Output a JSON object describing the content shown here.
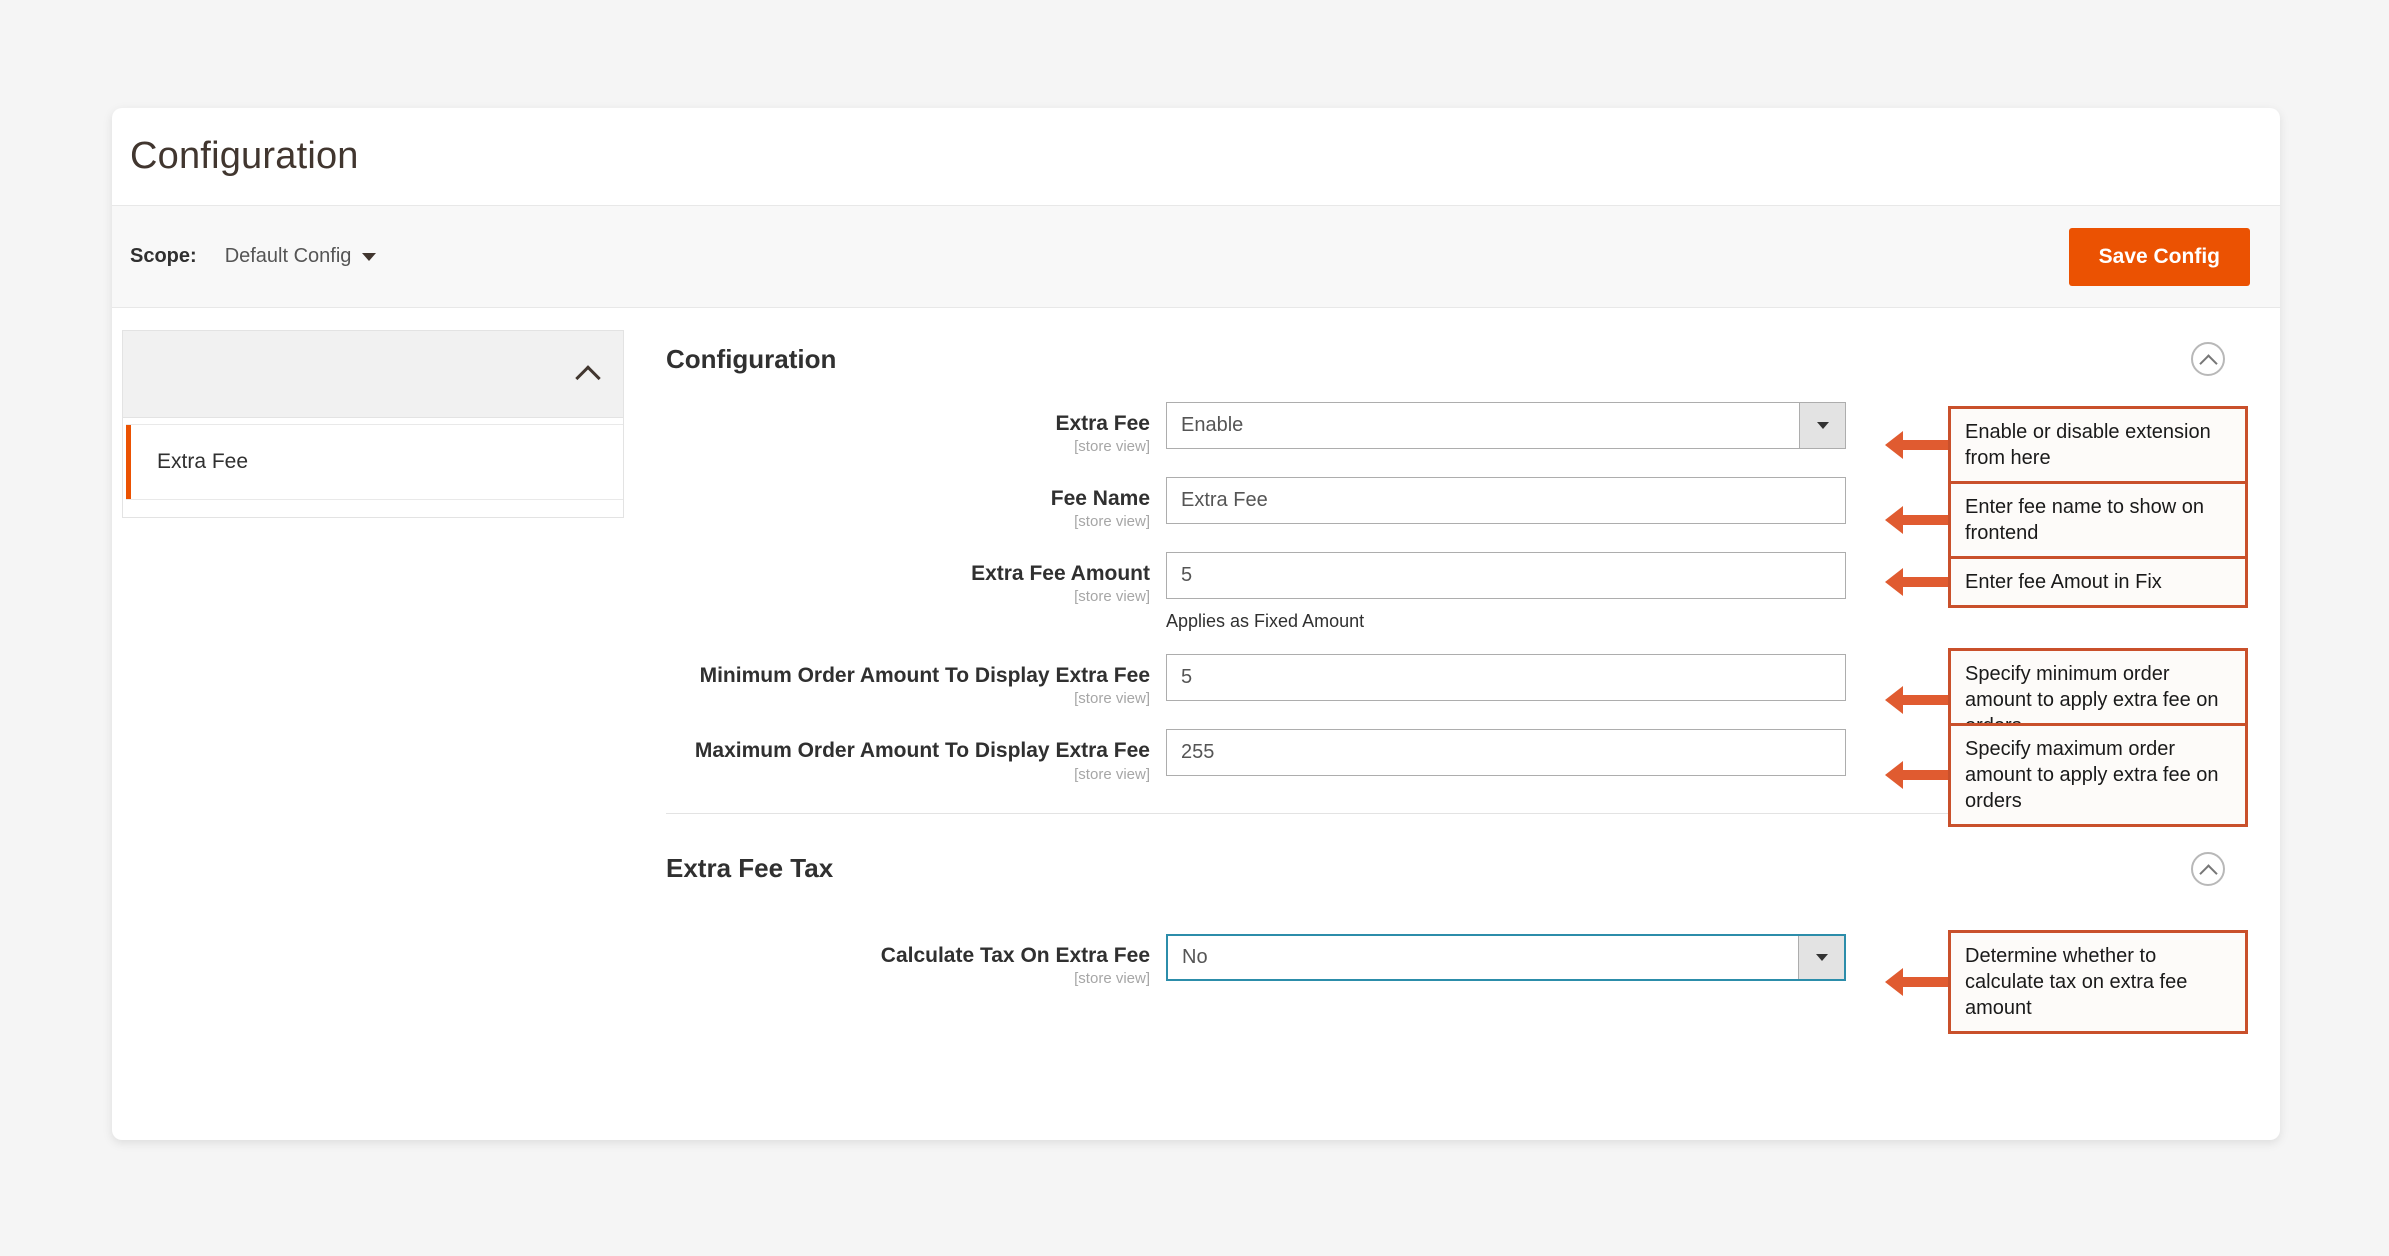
{
  "page": {
    "title": "Configuration",
    "background_color": "#f5f5f5",
    "accent_color": "#eb5202",
    "annotation_color": "#c9502b",
    "focus_color": "#2c8daa"
  },
  "scope_bar": {
    "label": "Scope:",
    "value": "Default Config",
    "caret_icon": "caret-down-icon",
    "save_label": "Save Config"
  },
  "nav": {
    "group_toggle_icon": "chevron-up-icon",
    "items": [
      {
        "label": "Extra Fee",
        "active": true
      }
    ]
  },
  "sections": [
    {
      "title": "Configuration",
      "collapse_icon": "chevron-up-circle-icon",
      "fields": [
        {
          "label": "Extra Fee",
          "scope": "[store view]",
          "type": "select",
          "value": "Enable",
          "focused": false,
          "note": "",
          "annotation": "Enable or disable extension from here"
        },
        {
          "label": "Fee Name",
          "scope": "[store view]",
          "type": "text",
          "value": "Extra Fee",
          "focused": false,
          "note": "",
          "annotation": "Enter fee name to show on frontend"
        },
        {
          "label": "Extra Fee Amount",
          "scope": "[store view]",
          "type": "text",
          "value": "5",
          "focused": false,
          "note": "Applies as Fixed Amount",
          "annotation": "Enter fee Amout in Fix"
        },
        {
          "label": "Minimum Order Amount To Display Extra Fee",
          "scope": "[store view]",
          "type": "text",
          "value": "5",
          "focused": false,
          "note": "",
          "annotation": "Specify minimum order amount to apply extra fee on orders"
        },
        {
          "label": "Maximum Order Amount To Display Extra Fee",
          "scope": "[store view]",
          "type": "text",
          "value": "255",
          "focused": false,
          "note": "",
          "annotation": "Specify maximum order amount to apply extra fee on orders"
        }
      ]
    },
    {
      "title": "Extra Fee Tax",
      "collapse_icon": "chevron-up-circle-icon",
      "fields": [
        {
          "label": "Calculate Tax On Extra Fee",
          "scope": "[store view]",
          "type": "select",
          "value": "No",
          "focused": true,
          "note": "",
          "annotation": "Determine whether to calculate tax on extra fee amount"
        }
      ]
    }
  ]
}
